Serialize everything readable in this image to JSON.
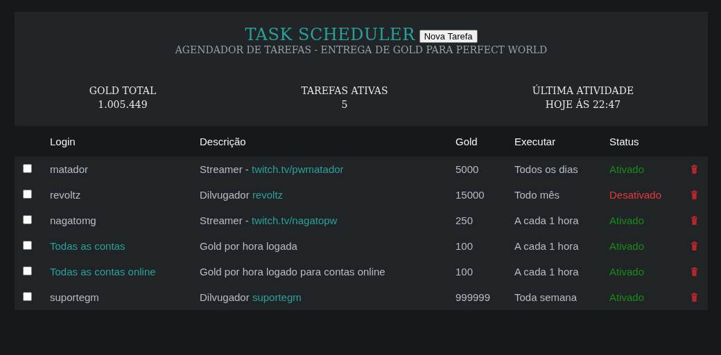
{
  "header": {
    "title": "TASK SCHEDULER",
    "new_task_button": "Nova Tarefa",
    "subtitle": "AGENDADOR DE TAREFAS - ENTREGA DE GOLD PARA PERFECT WORLD"
  },
  "stats": [
    {
      "label": "GOLD TOTAL",
      "value": "1.005.449"
    },
    {
      "label": "TAREFAS ATIVAS",
      "value": "5"
    },
    {
      "label": "ÚLTIMA ATIVIDADE",
      "value": "HOJE ÁS 22:47"
    }
  ],
  "table": {
    "columns": [
      "Login",
      "Descrição",
      "Gold",
      "Executar",
      "Status"
    ],
    "rows": [
      {
        "checked": false,
        "login": {
          "text": "matador",
          "kind": "plain"
        },
        "description": {
          "text": "Streamer - ",
          "link": "twitch.tv/pwmatador"
        },
        "gold": "5000",
        "schedule": "Todos os dias",
        "status": {
          "text": "Ativado",
          "active": true
        }
      },
      {
        "checked": false,
        "login": {
          "text": "revoltz",
          "kind": "plain"
        },
        "description": {
          "text": "Dilvugador ",
          "link": "revoltz"
        },
        "gold": "15000",
        "schedule": "Todo mês",
        "status": {
          "text": "Desativado",
          "active": false
        }
      },
      {
        "checked": false,
        "login": {
          "text": "nagatomg",
          "kind": "plain"
        },
        "description": {
          "text": "Streamer - ",
          "link": "twitch.tv/nagatopw"
        },
        "gold": "250",
        "schedule": "A cada 1 hora",
        "status": {
          "text": "Ativado",
          "active": true
        }
      },
      {
        "checked": false,
        "login": {
          "text": "Todas as contas",
          "kind": "link"
        },
        "description": {
          "text": "Gold por hora logada"
        },
        "gold": "100",
        "schedule": "A cada 1 hora",
        "status": {
          "text": "Ativado",
          "active": true
        }
      },
      {
        "checked": false,
        "login": {
          "text": "Todas as contas online",
          "kind": "link"
        },
        "description": {
          "text": "Gold por hora logado para contas online"
        },
        "gold": "100",
        "schedule": "A cada 1 hora",
        "status": {
          "text": "Ativado",
          "active": true
        }
      },
      {
        "checked": false,
        "login": {
          "text": "suportegm",
          "kind": "plain"
        },
        "description": {
          "text": "Dilvugador ",
          "link": "suportegm"
        },
        "gold": "999999",
        "schedule": "Toda semana",
        "status": {
          "text": "Ativado",
          "active": true
        }
      }
    ]
  }
}
